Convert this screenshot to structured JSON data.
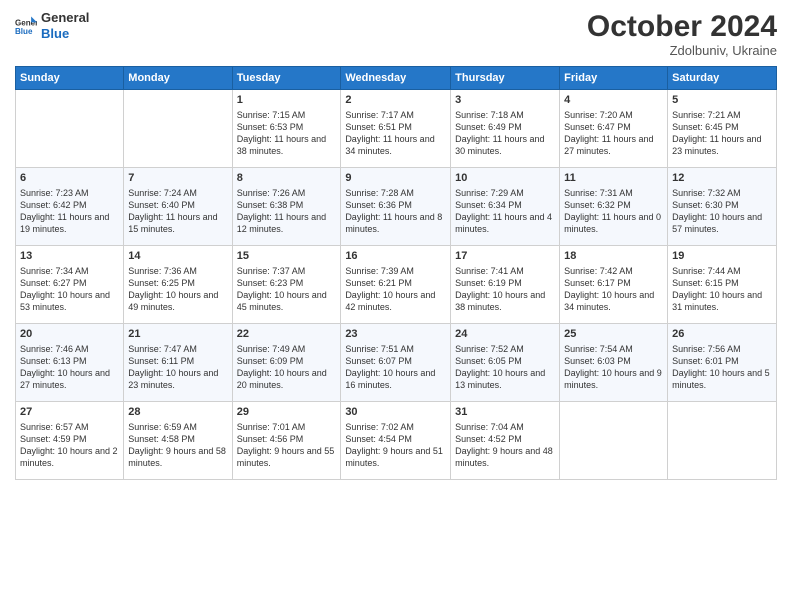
{
  "logo": {
    "line1": "General",
    "line2": "Blue"
  },
  "title": "October 2024",
  "subtitle": "Zdolbuniv, Ukraine",
  "days_of_week": [
    "Sunday",
    "Monday",
    "Tuesday",
    "Wednesday",
    "Thursday",
    "Friday",
    "Saturday"
  ],
  "weeks": [
    [
      {
        "day": "",
        "sunrise": "",
        "sunset": "",
        "daylight": ""
      },
      {
        "day": "",
        "sunrise": "",
        "sunset": "",
        "daylight": ""
      },
      {
        "day": "1",
        "sunrise": "Sunrise: 7:15 AM",
        "sunset": "Sunset: 6:53 PM",
        "daylight": "Daylight: 11 hours and 38 minutes."
      },
      {
        "day": "2",
        "sunrise": "Sunrise: 7:17 AM",
        "sunset": "Sunset: 6:51 PM",
        "daylight": "Daylight: 11 hours and 34 minutes."
      },
      {
        "day": "3",
        "sunrise": "Sunrise: 7:18 AM",
        "sunset": "Sunset: 6:49 PM",
        "daylight": "Daylight: 11 hours and 30 minutes."
      },
      {
        "day": "4",
        "sunrise": "Sunrise: 7:20 AM",
        "sunset": "Sunset: 6:47 PM",
        "daylight": "Daylight: 11 hours and 27 minutes."
      },
      {
        "day": "5",
        "sunrise": "Sunrise: 7:21 AM",
        "sunset": "Sunset: 6:45 PM",
        "daylight": "Daylight: 11 hours and 23 minutes."
      }
    ],
    [
      {
        "day": "6",
        "sunrise": "Sunrise: 7:23 AM",
        "sunset": "Sunset: 6:42 PM",
        "daylight": "Daylight: 11 hours and 19 minutes."
      },
      {
        "day": "7",
        "sunrise": "Sunrise: 7:24 AM",
        "sunset": "Sunset: 6:40 PM",
        "daylight": "Daylight: 11 hours and 15 minutes."
      },
      {
        "day": "8",
        "sunrise": "Sunrise: 7:26 AM",
        "sunset": "Sunset: 6:38 PM",
        "daylight": "Daylight: 11 hours and 12 minutes."
      },
      {
        "day": "9",
        "sunrise": "Sunrise: 7:28 AM",
        "sunset": "Sunset: 6:36 PM",
        "daylight": "Daylight: 11 hours and 8 minutes."
      },
      {
        "day": "10",
        "sunrise": "Sunrise: 7:29 AM",
        "sunset": "Sunset: 6:34 PM",
        "daylight": "Daylight: 11 hours and 4 minutes."
      },
      {
        "day": "11",
        "sunrise": "Sunrise: 7:31 AM",
        "sunset": "Sunset: 6:32 PM",
        "daylight": "Daylight: 11 hours and 0 minutes."
      },
      {
        "day": "12",
        "sunrise": "Sunrise: 7:32 AM",
        "sunset": "Sunset: 6:30 PM",
        "daylight": "Daylight: 10 hours and 57 minutes."
      }
    ],
    [
      {
        "day": "13",
        "sunrise": "Sunrise: 7:34 AM",
        "sunset": "Sunset: 6:27 PM",
        "daylight": "Daylight: 10 hours and 53 minutes."
      },
      {
        "day": "14",
        "sunrise": "Sunrise: 7:36 AM",
        "sunset": "Sunset: 6:25 PM",
        "daylight": "Daylight: 10 hours and 49 minutes."
      },
      {
        "day": "15",
        "sunrise": "Sunrise: 7:37 AM",
        "sunset": "Sunset: 6:23 PM",
        "daylight": "Daylight: 10 hours and 45 minutes."
      },
      {
        "day": "16",
        "sunrise": "Sunrise: 7:39 AM",
        "sunset": "Sunset: 6:21 PM",
        "daylight": "Daylight: 10 hours and 42 minutes."
      },
      {
        "day": "17",
        "sunrise": "Sunrise: 7:41 AM",
        "sunset": "Sunset: 6:19 PM",
        "daylight": "Daylight: 10 hours and 38 minutes."
      },
      {
        "day": "18",
        "sunrise": "Sunrise: 7:42 AM",
        "sunset": "Sunset: 6:17 PM",
        "daylight": "Daylight: 10 hours and 34 minutes."
      },
      {
        "day": "19",
        "sunrise": "Sunrise: 7:44 AM",
        "sunset": "Sunset: 6:15 PM",
        "daylight": "Daylight: 10 hours and 31 minutes."
      }
    ],
    [
      {
        "day": "20",
        "sunrise": "Sunrise: 7:46 AM",
        "sunset": "Sunset: 6:13 PM",
        "daylight": "Daylight: 10 hours and 27 minutes."
      },
      {
        "day": "21",
        "sunrise": "Sunrise: 7:47 AM",
        "sunset": "Sunset: 6:11 PM",
        "daylight": "Daylight: 10 hours and 23 minutes."
      },
      {
        "day": "22",
        "sunrise": "Sunrise: 7:49 AM",
        "sunset": "Sunset: 6:09 PM",
        "daylight": "Daylight: 10 hours and 20 minutes."
      },
      {
        "day": "23",
        "sunrise": "Sunrise: 7:51 AM",
        "sunset": "Sunset: 6:07 PM",
        "daylight": "Daylight: 10 hours and 16 minutes."
      },
      {
        "day": "24",
        "sunrise": "Sunrise: 7:52 AM",
        "sunset": "Sunset: 6:05 PM",
        "daylight": "Daylight: 10 hours and 13 minutes."
      },
      {
        "day": "25",
        "sunrise": "Sunrise: 7:54 AM",
        "sunset": "Sunset: 6:03 PM",
        "daylight": "Daylight: 10 hours and 9 minutes."
      },
      {
        "day": "26",
        "sunrise": "Sunrise: 7:56 AM",
        "sunset": "Sunset: 6:01 PM",
        "daylight": "Daylight: 10 hours and 5 minutes."
      }
    ],
    [
      {
        "day": "27",
        "sunrise": "Sunrise: 6:57 AM",
        "sunset": "Sunset: 4:59 PM",
        "daylight": "Daylight: 10 hours and 2 minutes."
      },
      {
        "day": "28",
        "sunrise": "Sunrise: 6:59 AM",
        "sunset": "Sunset: 4:58 PM",
        "daylight": "Daylight: 9 hours and 58 minutes."
      },
      {
        "day": "29",
        "sunrise": "Sunrise: 7:01 AM",
        "sunset": "Sunset: 4:56 PM",
        "daylight": "Daylight: 9 hours and 55 minutes."
      },
      {
        "day": "30",
        "sunrise": "Sunrise: 7:02 AM",
        "sunset": "Sunset: 4:54 PM",
        "daylight": "Daylight: 9 hours and 51 minutes."
      },
      {
        "day": "31",
        "sunrise": "Sunrise: 7:04 AM",
        "sunset": "Sunset: 4:52 PM",
        "daylight": "Daylight: 9 hours and 48 minutes."
      },
      {
        "day": "",
        "sunrise": "",
        "sunset": "",
        "daylight": ""
      },
      {
        "day": "",
        "sunrise": "",
        "sunset": "",
        "daylight": ""
      }
    ]
  ]
}
